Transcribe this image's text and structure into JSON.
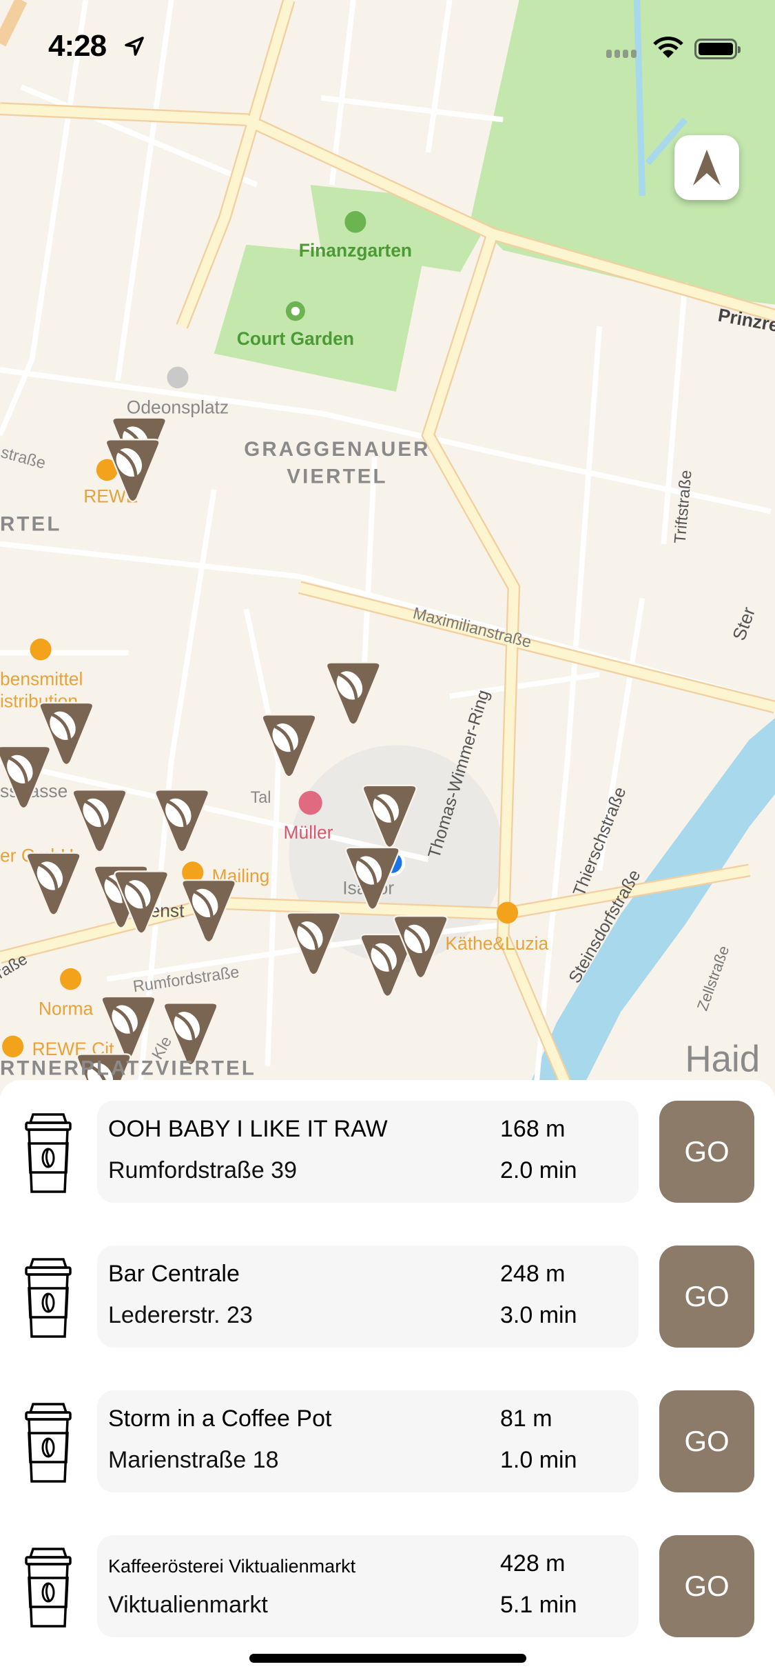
{
  "status_bar": {
    "time": "4:28"
  },
  "map": {
    "labels": {
      "finanzgarten": "Finanzgarten",
      "court_garden": "Court Garden",
      "odeonsplatz": "Odeonsplatz",
      "graggenauer": "GRAGGENAUER",
      "viertel": "VIERTEL",
      "rewe": "REWE",
      "rtel": "RTEL",
      "strasse_left": "straße",
      "maximilianstrasse": "Maximilianstraße",
      "thomas_wimmer_ring": "Thomas-Wimmer-Ring",
      "triftstrasse": "Triftstraße",
      "prinzregenten": "Prinzre",
      "lebensmittel": "bensmittel",
      "distribution": "istribution",
      "muller": "Müller",
      "tal": "Tal",
      "isartor": "Isartor",
      "mailing": "Mailing",
      "kathe_luzia": "Käthe&Luzia",
      "thierschstrasse": "Thierschstraße",
      "steinsdorfstrasse": "Steinsdorfstraße",
      "zellstrasse": "Zellstraße",
      "rumfordstrasse": "Rumfordstraße",
      "norma": "Norma",
      "rewe_city": "REWE Cit",
      "gmbh": "er GmbH",
      "sse": "sstrasse",
      "gartnerplatz": "RTNERPLATZVIERTEL",
      "haid": "Haid",
      "ster": "Ster",
      "kle": "Kle",
      "strasse_bl": "raße",
      "ens": "enst"
    },
    "colors": {
      "land": "#f8f3ea",
      "park": "#c3e7ad",
      "water": "#a7d8ec",
      "road_major": "#fdf5cf",
      "pin": "#7a6552"
    }
  },
  "cafes": [
    {
      "name": "OOH BABY I LIKE IT RAW",
      "address": "Rumfordstraße 39",
      "distance": "168 m",
      "duration": "2.0 min",
      "go": "GO"
    },
    {
      "name": "Bar Centrale",
      "address": "Ledererstr. 23",
      "distance": "248 m",
      "duration": "3.0 min",
      "go": "GO"
    },
    {
      "name": "Storm in a Coffee Pot",
      "address": "Marienstraße 18",
      "distance": "81 m",
      "duration": "1.0 min",
      "go": "GO"
    },
    {
      "name": "Kaffeerösterei Viktualienmarkt",
      "address": "Viktualienmarkt",
      "distance": "428 m",
      "duration": "5.1 min",
      "go": "GO"
    }
  ]
}
